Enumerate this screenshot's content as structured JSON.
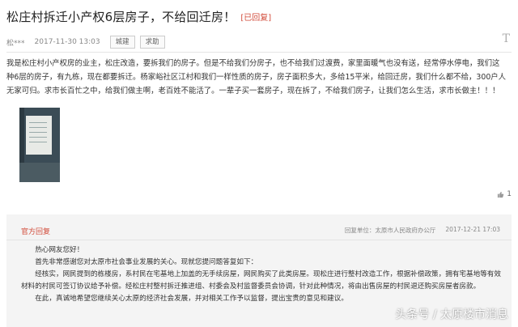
{
  "post": {
    "title": "松庄村拆迁小产权6层房子，不给回迁房！",
    "status": "[已回复]",
    "user": "松***",
    "date": "2017-11-30 13:03",
    "tags": [
      "城建",
      "求助"
    ],
    "font_size_icon": "T",
    "body": "我是松庄村小产权房的业主，松庄改造，要拆我们的房子。但是不给我们分房子，也不给我们过渡费，家里面暖气也没有送，经常停水停电，我们这种6层的房子，有九栋，现在都要拆迁。杨家峪社区江村和我们一样性质的房子，房子面积多大，多给15平米，给回迁房，我们什么都不给，300户人无家可归。求市长百忙之中，给我们做主啊，老百姓不能活了。一辈子买一套房子，现在拆了，不给我们房子，让我们怎么生活，求市长做主！！！",
    "like_count": "1"
  },
  "reply": {
    "header": "官方回复",
    "unit_label": "回复单位：",
    "unit": "太原市人民政府办公厅",
    "date": "2017-12-21 17:03",
    "paragraphs": [
      "热心网友您好！",
      "首先非常感谢您对太原市社会事业发展的关心。现就您提问题答复如下：",
      "经核实，网民提到的栋楼房，系村民在宅基地上加盖的无手续房屋，网民购买了此类房屋。现松庄进行整村改造工作，根据补偿政策，拥有宅基地等有效材料的村民可签订协议给予补偿。经松庄村整村拆迁推进组、村委会及村监督委员会协调，针对此种情况，将由出售房屋的村民退还购买房屋者房款。",
      "在此，真诚地希望您继续关心太原的经济社会发展，并对相关工作予以监督，提出宝贵的意见和建议。"
    ]
  },
  "watermark": "头条号 / 太原楼市消息"
}
